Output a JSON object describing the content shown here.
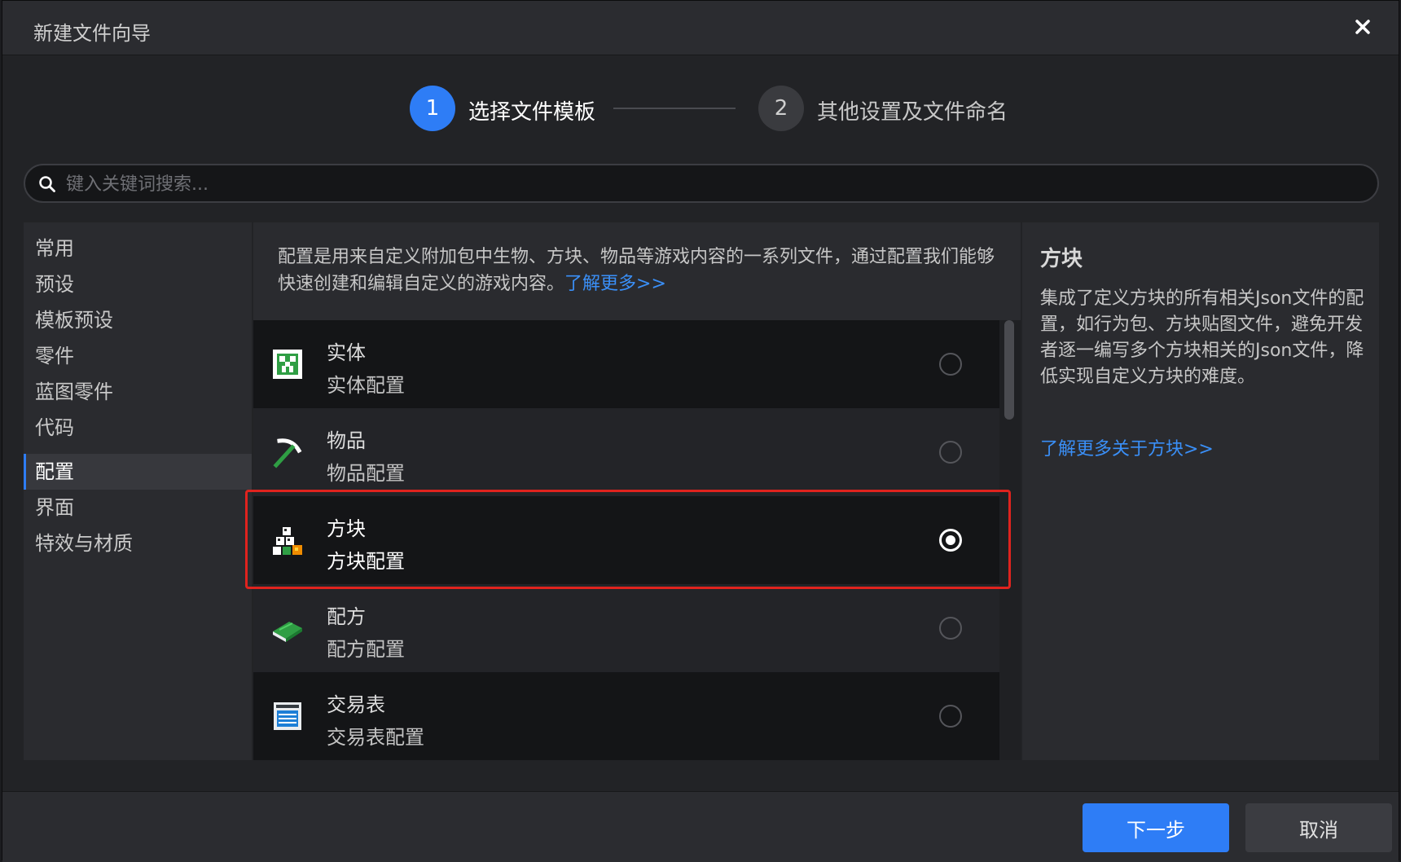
{
  "window": {
    "title": "新建文件向导"
  },
  "steps": [
    {
      "number": "1",
      "label": "选择文件模板"
    },
    {
      "number": "2",
      "label": "其他设置及文件命名"
    }
  ],
  "search": {
    "placeholder": "键入关键词搜索..."
  },
  "sidebar": {
    "items": [
      {
        "label": "常用"
      },
      {
        "label": "预设"
      },
      {
        "label": "模板预设"
      },
      {
        "label": "零件"
      },
      {
        "label": "蓝图零件"
      },
      {
        "label": "代码"
      },
      {
        "label": "配置"
      },
      {
        "label": "界面"
      },
      {
        "label": "特效与材质"
      }
    ],
    "active": "配置"
  },
  "description": {
    "text": "配置是用来自定义附加包中生物、方块、物品等游戏内容的一系列文件，通过配置我们能够快速创建和编辑自定义的游戏内容。",
    "link": "了解更多>>"
  },
  "templates": [
    {
      "title": "实体",
      "subtitle": "实体配置",
      "icon": "creeper-icon",
      "selected": false
    },
    {
      "title": "物品",
      "subtitle": "物品配置",
      "icon": "pickaxe-icon",
      "selected": false
    },
    {
      "title": "方块",
      "subtitle": "方块配置",
      "icon": "blocks-icon",
      "selected": true
    },
    {
      "title": "配方",
      "subtitle": "配方配置",
      "icon": "book-icon",
      "selected": false
    },
    {
      "title": "交易表",
      "subtitle": "交易表配置",
      "icon": "trade-table-icon",
      "selected": false
    }
  ],
  "detail": {
    "title": "方块",
    "description": "集成了定义方块的所有相关Json文件的配置，如行为包、方块贴图文件，避免开发者逐一编写多个方块相关的Json文件，降低实现自定义方块的难度。",
    "link": "了解更多关于方块>>"
  },
  "footer": {
    "next_label": "下一步",
    "cancel_label": "取消"
  },
  "colors": {
    "accent": "#2e7df6",
    "link": "#3a8ff7",
    "highlight": "#e0231e"
  }
}
